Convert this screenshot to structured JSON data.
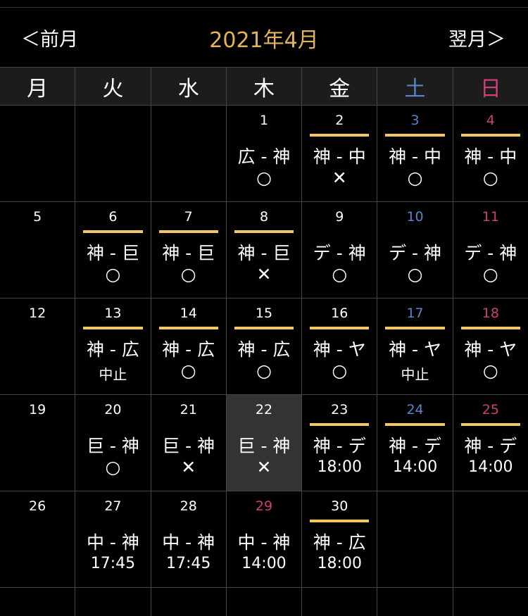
{
  "nav": {
    "prev_label": "＜前月",
    "title": "2021年4月",
    "next_label": "翌月＞"
  },
  "weekdays": [
    "月",
    "火",
    "水",
    "木",
    "金",
    "土",
    "日"
  ],
  "weeks": [
    [
      {},
      {},
      {},
      {
        "d": "1",
        "m": "広 - 神",
        "r": "○"
      },
      {
        "d": "2",
        "m": "神 - 中",
        "r": "✕",
        "line": true
      },
      {
        "d": "3",
        "m": "神 - 中",
        "r": "○",
        "line": true,
        "c": "sat"
      },
      {
        "d": "4",
        "m": "神 - 中",
        "r": "○",
        "line": true,
        "c": "sun"
      }
    ],
    [
      {
        "d": "5"
      },
      {
        "d": "6",
        "m": "神 - 巨",
        "r": "○",
        "line": true
      },
      {
        "d": "7",
        "m": "神 - 巨",
        "r": "○",
        "line": true
      },
      {
        "d": "8",
        "m": "神 - 巨",
        "r": "✕",
        "line": true
      },
      {
        "d": "9",
        "m": "デ - 神",
        "r": "○"
      },
      {
        "d": "10",
        "m": "デ - 神",
        "r": "○",
        "c": "sat"
      },
      {
        "d": "11",
        "m": "デ - 神",
        "r": "○",
        "c": "sun"
      }
    ],
    [
      {
        "d": "12"
      },
      {
        "d": "13",
        "m": "神 - 広",
        "r": "中止",
        "line": true,
        "small": true
      },
      {
        "d": "14",
        "m": "神 - 広",
        "r": "○",
        "line": true
      },
      {
        "d": "15",
        "m": "神 - 広",
        "r": "○",
        "line": true
      },
      {
        "d": "16",
        "m": "神 - ヤ",
        "r": "○",
        "line": true
      },
      {
        "d": "17",
        "m": "神 - ヤ",
        "r": "中止",
        "line": true,
        "small": true,
        "c": "sat"
      },
      {
        "d": "18",
        "m": "神 - ヤ",
        "r": "○",
        "line": true,
        "c": "sun"
      }
    ],
    [
      {
        "d": "19"
      },
      {
        "d": "20",
        "m": "巨 - 神",
        "r": "○"
      },
      {
        "d": "21",
        "m": "巨 - 神",
        "r": "✕"
      },
      {
        "d": "22",
        "m": "巨 - 神",
        "r": "✕",
        "selected": true
      },
      {
        "d": "23",
        "m": "神 - デ",
        "r": "18:00",
        "line": true,
        "time": true
      },
      {
        "d": "24",
        "m": "神 - デ",
        "r": "14:00",
        "line": true,
        "time": true,
        "c": "sat"
      },
      {
        "d": "25",
        "m": "神 - デ",
        "r": "14:00",
        "line": true,
        "time": true,
        "c": "sun"
      }
    ],
    [
      {
        "d": "26"
      },
      {
        "d": "27",
        "m": "中 - 神",
        "r": "17:45",
        "time": true
      },
      {
        "d": "28",
        "m": "中 - 神",
        "r": "17:45",
        "time": true
      },
      {
        "d": "29",
        "m": "中 - 神",
        "r": "14:00",
        "time": true,
        "c": "sun"
      },
      {
        "d": "30",
        "m": "神 - 広",
        "r": "18:00",
        "line": true,
        "time": true
      },
      {},
      {}
    ]
  ],
  "colors": {
    "home_line": "#f3c862",
    "saturday": "#5b83c9",
    "sunday": "#cc3f7a",
    "title": "#e2b35c"
  }
}
